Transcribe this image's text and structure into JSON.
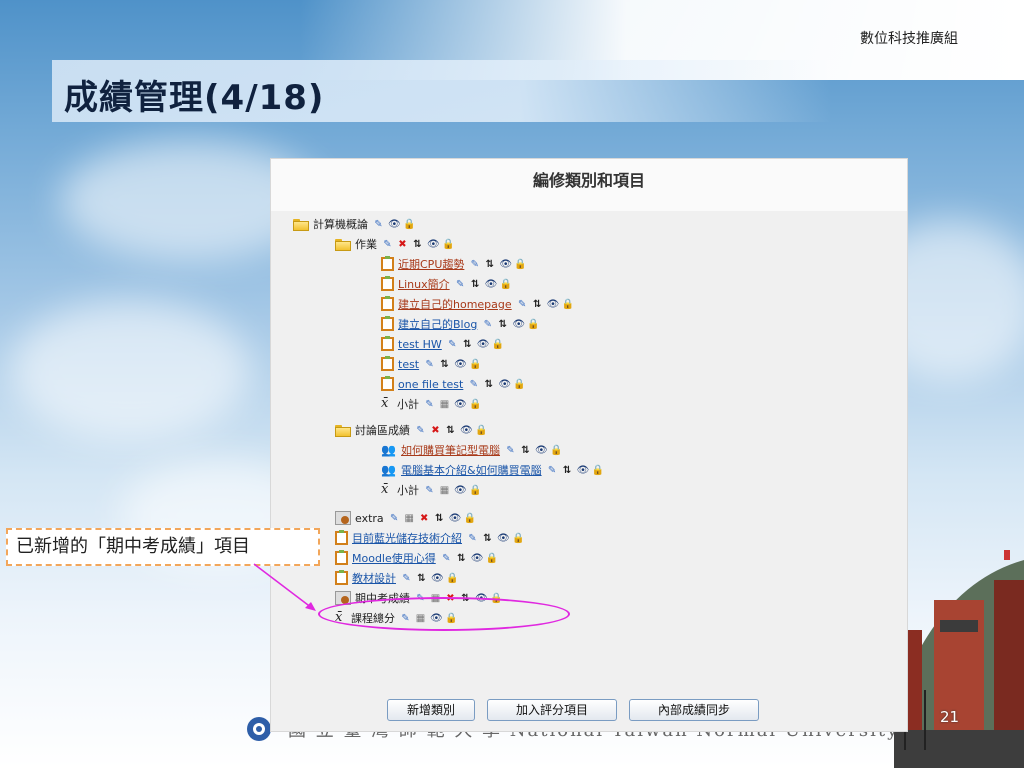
{
  "header": {
    "org_label": "數位科技推廣組",
    "title": "成績管理(4/18)"
  },
  "footer": {
    "university": "國 立 臺 灣 師 範 大 學  National Taiwan Normal University",
    "page_number": "21"
  },
  "window": {
    "title": "編修類別和項目",
    "tree": [
      {
        "label": "計算機概論",
        "type": "folder",
        "link": false,
        "actions": [
          "edit",
          "eye",
          "lock"
        ]
      },
      {
        "label": "作業",
        "type": "folder",
        "link": false,
        "actions": [
          "edit",
          "delete",
          "move",
          "eye",
          "lock"
        ]
      },
      {
        "label": "近期CPU趨勢",
        "type": "doc",
        "link": true,
        "actions": [
          "edit",
          "move",
          "eye",
          "lock"
        ]
      },
      {
        "label": "Linux簡介",
        "type": "doc",
        "link": true,
        "actions": [
          "edit",
          "move",
          "eye",
          "lock"
        ]
      },
      {
        "label": "建立自己的homepage",
        "type": "doc",
        "link": true,
        "actions": [
          "edit",
          "move",
          "eye",
          "lock"
        ]
      },
      {
        "label": "建立自己的Blog",
        "type": "doc",
        "link": true,
        "actions": [
          "edit",
          "move",
          "eye",
          "lock"
        ]
      },
      {
        "label": "test HW",
        "type": "doc",
        "link": true,
        "actions": [
          "edit",
          "move",
          "eye",
          "lock"
        ]
      },
      {
        "label": "test",
        "type": "doc",
        "link": true,
        "actions": [
          "edit",
          "move",
          "eye",
          "lock"
        ]
      },
      {
        "label": "one file test",
        "type": "doc",
        "link": true,
        "actions": [
          "edit",
          "move",
          "eye",
          "lock"
        ]
      },
      {
        "label": "小計",
        "type": "xbar",
        "link": false,
        "actions": [
          "edit",
          "calc",
          "eye",
          "lock"
        ]
      },
      {
        "label": "討論區成績",
        "type": "folder",
        "link": false,
        "actions": [
          "edit",
          "delete",
          "move",
          "eye",
          "lock"
        ]
      },
      {
        "label": "如何購買筆記型電腦",
        "type": "users",
        "link": true,
        "actions": [
          "edit",
          "move",
          "eye",
          "lock"
        ]
      },
      {
        "label": "電腦基本介紹&如何購買電腦",
        "type": "users",
        "link": true,
        "actions": [
          "edit",
          "move",
          "eye",
          "lock"
        ]
      },
      {
        "label": "小計",
        "type": "xbar",
        "link": false,
        "actions": [
          "edit",
          "calc",
          "eye",
          "lock"
        ]
      },
      {
        "label": "extra",
        "type": "gear",
        "link": false,
        "actions": [
          "edit",
          "calc",
          "delete",
          "move",
          "eye",
          "lock"
        ]
      },
      {
        "label": "目前藍光儲存技術介紹",
        "type": "doc",
        "link": true,
        "actions": [
          "edit",
          "move",
          "eye",
          "lock"
        ]
      },
      {
        "label": "Moodle使用心得",
        "type": "doc",
        "link": true,
        "actions": [
          "edit",
          "move",
          "eye",
          "lock"
        ]
      },
      {
        "label": "教材設計",
        "type": "doc",
        "link": true,
        "actions": [
          "edit",
          "move",
          "eye",
          "lock"
        ]
      },
      {
        "label": "期中考成績",
        "type": "gear",
        "link": false,
        "actions": [
          "edit",
          "calc",
          "delete",
          "move",
          "eye",
          "lock"
        ]
      },
      {
        "label": "課程總分",
        "type": "xbar",
        "link": false,
        "actions": [
          "edit",
          "calc",
          "eye",
          "lock"
        ]
      }
    ],
    "buttons": {
      "add_category": "新增類別",
      "add_grade_item": "加入評分項目",
      "sync_grades": "內部成績同步"
    }
  },
  "callout": {
    "text": "已新增的「期中考成績」項目"
  }
}
